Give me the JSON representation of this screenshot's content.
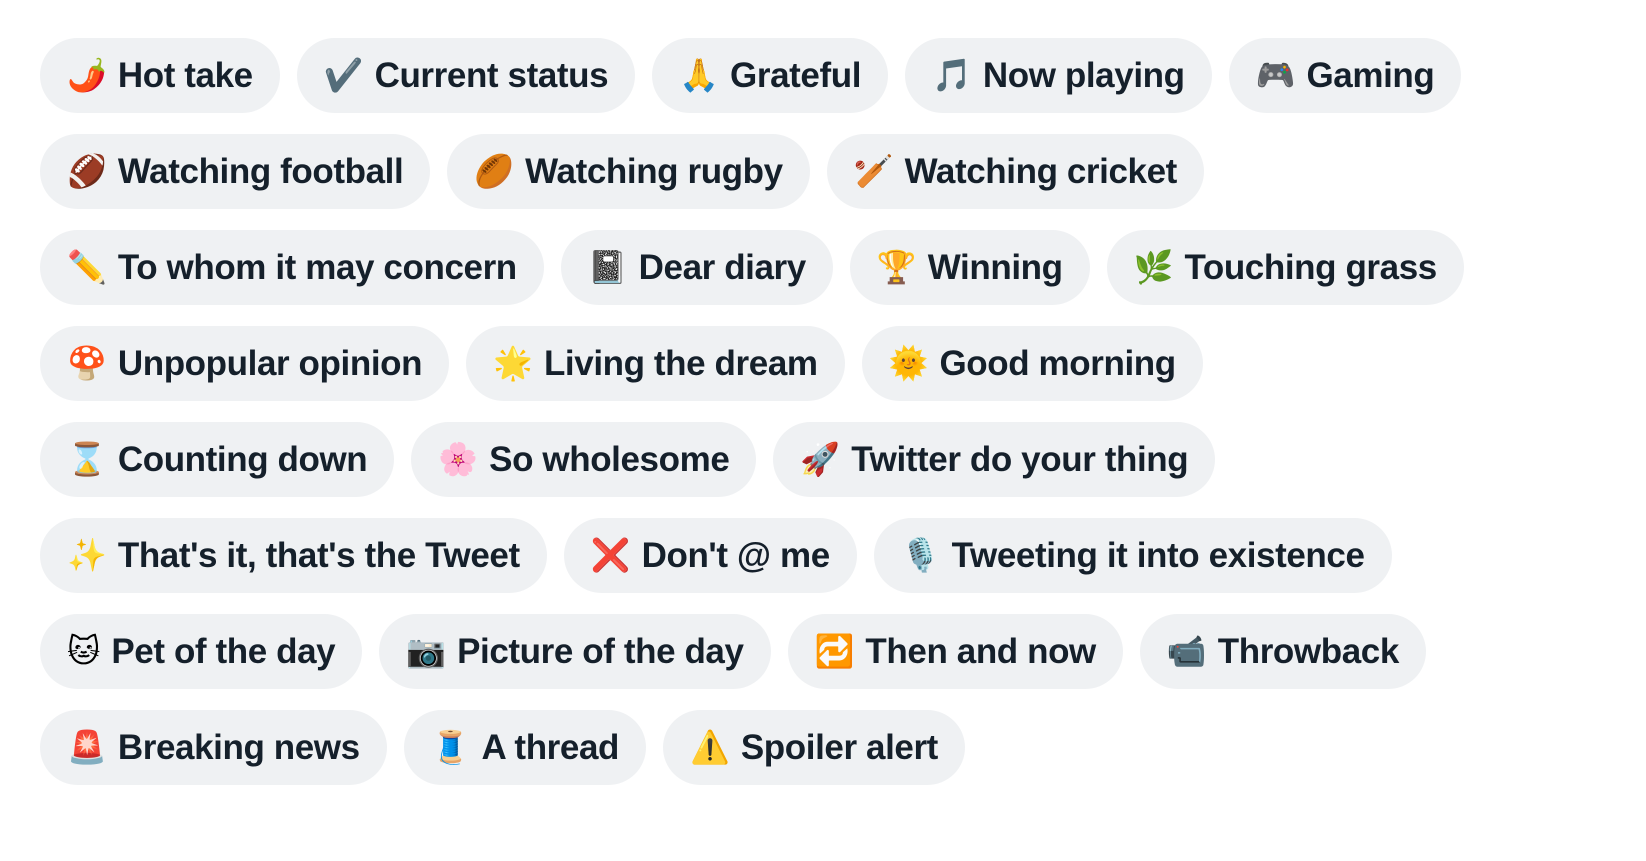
{
  "theme": {
    "page_background": "#ffffff",
    "chip_background": "#eff1f3",
    "chip_text_color": "#15202b"
  },
  "chip_rows": [
    {
      "chips": [
        {
          "emoji": "🌶️",
          "icon_name": "hot-pepper-emoji",
          "label": "Hot take"
        },
        {
          "emoji": "✔️",
          "icon_name": "check-mark-emoji",
          "label": "Current status"
        },
        {
          "emoji": "🙏",
          "icon_name": "folded-hands-emoji",
          "label": "Grateful"
        },
        {
          "emoji": "🎵",
          "icon_name": "musical-note-emoji",
          "label": "Now playing"
        },
        {
          "emoji": "🎮",
          "icon_name": "video-game-controller-emoji",
          "label": "Gaming"
        }
      ]
    },
    {
      "chips": [
        {
          "emoji": "🏈",
          "icon_name": "american-football-emoji",
          "label": "Watching football"
        },
        {
          "emoji": "🏉",
          "icon_name": "rugby-football-emoji",
          "label": "Watching rugby"
        },
        {
          "emoji": "🏏",
          "icon_name": "cricket-bat-and-ball-emoji",
          "label": "Watching cricket"
        }
      ]
    },
    {
      "chips": [
        {
          "emoji": "✏️",
          "icon_name": "pencil-emoji",
          "label": "To whom it may concern"
        },
        {
          "emoji": "📓",
          "icon_name": "notebook-emoji",
          "label": "Dear diary"
        },
        {
          "emoji": "🏆",
          "icon_name": "trophy-emoji",
          "label": "Winning"
        },
        {
          "emoji": "🌿",
          "icon_name": "herb-emoji",
          "label": "Touching grass"
        }
      ]
    },
    {
      "chips": [
        {
          "emoji": "🍄",
          "icon_name": "mushroom-emoji",
          "label": "Unpopular opinion"
        },
        {
          "emoji": "🌟",
          "icon_name": "glowing-star-emoji",
          "label": "Living the dream"
        },
        {
          "emoji": "🌞",
          "icon_name": "sun-with-face-emoji",
          "label": "Good morning"
        }
      ]
    },
    {
      "chips": [
        {
          "emoji": "⌛",
          "icon_name": "hourglass-emoji",
          "label": "Counting down"
        },
        {
          "emoji": "🌸",
          "icon_name": "cherry-blossom-emoji",
          "label": "So wholesome"
        },
        {
          "emoji": "🚀",
          "icon_name": "rocket-emoji",
          "label": "Twitter do your thing"
        }
      ]
    },
    {
      "chips": [
        {
          "emoji": "✨",
          "icon_name": "sparkles-emoji",
          "label": "That's it, that's the Tweet"
        },
        {
          "emoji": "❌",
          "icon_name": "cross-mark-emoji",
          "label": "Don't @ me"
        },
        {
          "emoji": "🎙️",
          "icon_name": "studio-microphone-emoji",
          "label": "Tweeting it into existence"
        }
      ]
    },
    {
      "chips": [
        {
          "emoji": "🐱",
          "icon_name": "cat-face-emoji",
          "label": "Pet of the day"
        },
        {
          "emoji": "📷",
          "icon_name": "camera-emoji",
          "label": "Picture of the day"
        },
        {
          "emoji": "🔁",
          "icon_name": "repeat-arrows-emoji",
          "label": "Then and now"
        },
        {
          "emoji": "📹",
          "icon_name": "video-camera-emoji",
          "label": "Throwback"
        }
      ]
    },
    {
      "chips": [
        {
          "emoji": "🚨",
          "icon_name": "police-light-emoji",
          "label": "Breaking news"
        },
        {
          "emoji": "🧵",
          "icon_name": "thread-spool-emoji",
          "label": "A thread"
        },
        {
          "emoji": "⚠️",
          "icon_name": "warning-sign-emoji",
          "label": "Spoiler alert"
        }
      ]
    }
  ]
}
